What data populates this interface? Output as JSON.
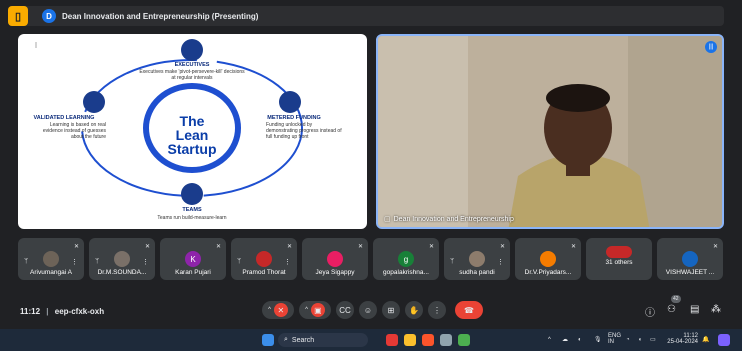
{
  "topbar": {
    "app_icon": "meet-presentation-icon",
    "badge": "D",
    "title": "Dean Innovation and Entrepreneurship (Presenting)"
  },
  "slide": {
    "center": [
      "The",
      "Lean",
      "Startup"
    ],
    "executives": {
      "heading": "EXECUTIVES",
      "text": "Executives make 'pivot-persevere-kill' decisions at regular intervals"
    },
    "metered": {
      "heading": "METERED FUNDING",
      "text": "Funding unlocked by demonstrating progress instead of full funding up front"
    },
    "teams": {
      "heading": "TEAMS",
      "text": "Teams run build-measure-learn"
    },
    "validated": {
      "heading": "VALIDATED LEARNING",
      "text": "Learning is based on real evidence instead of guesses about the future"
    }
  },
  "camera": {
    "label": "Dean Innovation and Entrepreneurship"
  },
  "participants": [
    {
      "name": "Arivumangai A",
      "avatar": "photo"
    },
    {
      "name": "Dr.M.SOUNDA...",
      "avatar": "photo"
    },
    {
      "name": "Karan Pujari",
      "avatar": "K",
      "color": "#8e24aa"
    },
    {
      "name": "Pramod Thorat",
      "avatar": "photo"
    },
    {
      "name": "Jeya Sigappy",
      "avatar": "photo"
    },
    {
      "name": "gopalakrishna...",
      "avatar": "g",
      "color": "#188038"
    },
    {
      "name": "sudha pandi",
      "avatar": "photo"
    },
    {
      "name": "Dr.V.Priyadars...",
      "avatar": "photo"
    },
    {
      "name": "31 others",
      "avatar": "group"
    },
    {
      "name": "VISHWAJEET ...",
      "avatar": "photo"
    }
  ],
  "meeting": {
    "time": "11:12",
    "separator": "|",
    "code": "eep-cfxk-oxh",
    "people_count": "42"
  },
  "controls": [
    "mic-off-icon",
    "camera-off-icon",
    "captions-icon",
    "emoji-icon",
    "present-icon",
    "raise-hand-icon",
    "more-icon",
    "end-call-icon"
  ],
  "taskbar": {
    "search": "Search",
    "lang_top": "ENG",
    "lang_bottom": "IN",
    "time": "11:12",
    "date": "25-04-2024"
  }
}
